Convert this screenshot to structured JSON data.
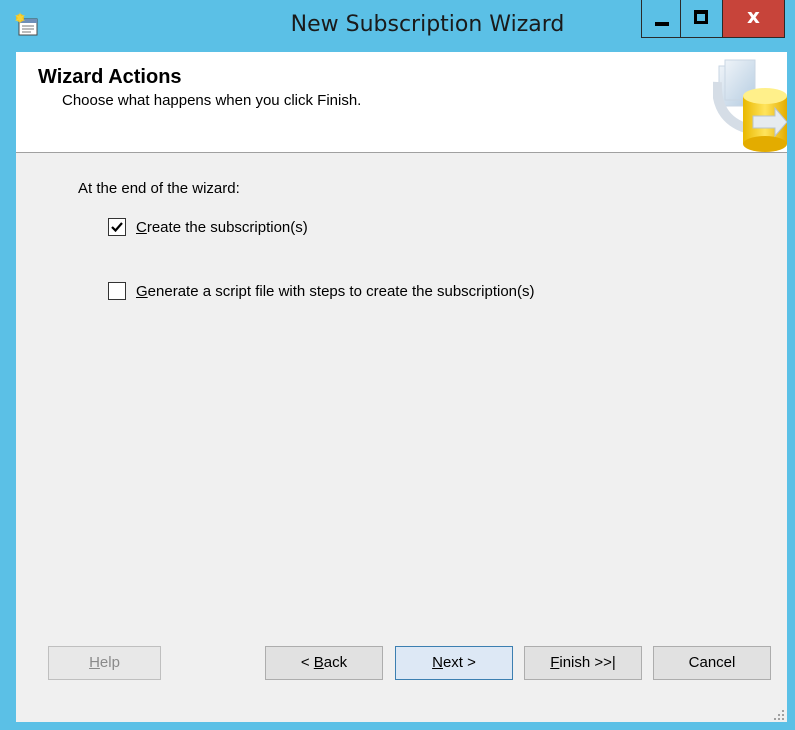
{
  "window": {
    "title": "New Subscription Wizard",
    "close_glyph": "x"
  },
  "header": {
    "title": "Wizard Actions",
    "subtitle": "Choose what happens when you click Finish."
  },
  "section": {
    "label": "At the end of the wizard:"
  },
  "options": [
    {
      "mnemonic": "C",
      "rest": "reate the subscription(s)",
      "checked": true
    },
    {
      "mnemonic": "G",
      "rest": "enerate a script file with steps to create the subscription(s)",
      "checked": false
    }
  ],
  "buttons": {
    "help": {
      "mnemonic": "H",
      "rest": "elp",
      "enabled": false
    },
    "back": {
      "prefix": "< ",
      "mnemonic": "B",
      "rest": "ack"
    },
    "next": {
      "mnemonic": "N",
      "rest": "ext >"
    },
    "finish": {
      "mnemonic": "F",
      "rest": "inish >>|"
    },
    "cancel": {
      "label": "Cancel"
    }
  },
  "colors": {
    "titlebar": "#5bc0e6",
    "close": "#c7443a",
    "client": "#f0f0f0"
  },
  "icons": {
    "app": "wizard-app-icon",
    "header": "database-publication-graphic"
  }
}
